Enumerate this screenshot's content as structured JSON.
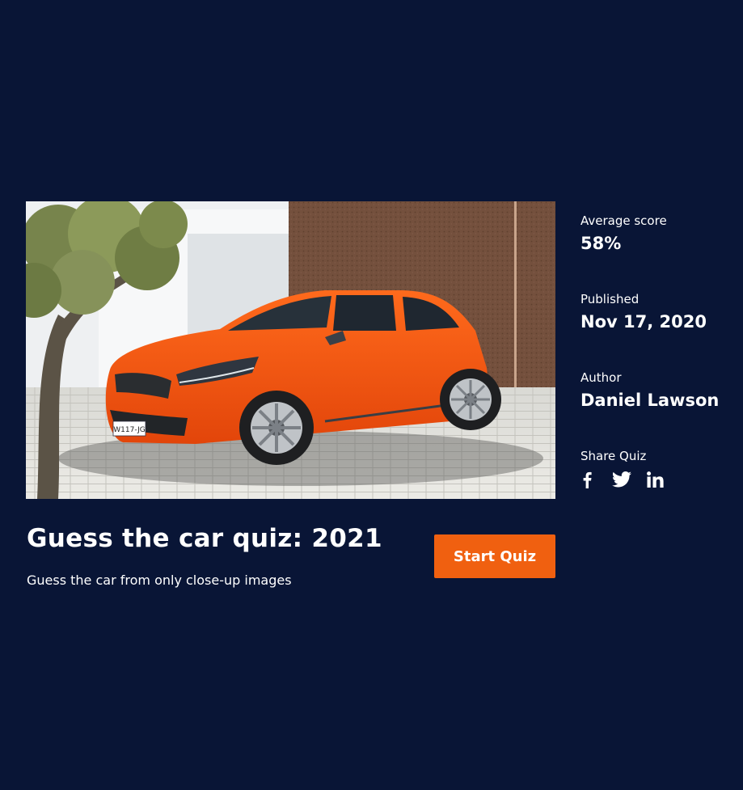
{
  "quiz": {
    "title": "Guess the car quiz: 2021",
    "description": "Guess the car from only close-up images",
    "start_label": "Start Quiz",
    "cover_image": "orange-hatchback-car-photo",
    "plate_text": "W117-JG"
  },
  "stats": {
    "score_label": "Average score",
    "score_value": "58%",
    "published_label": "Published",
    "published_value": "Nov 17, 2020",
    "author_label": "Author",
    "author_value": "Daniel Lawson",
    "share_label": "Share Quiz",
    "share_icons": [
      "facebook-icon",
      "twitter-icon",
      "linkedin-icon"
    ]
  },
  "colors": {
    "background": "#091536",
    "accent": "#f06010",
    "text": "#ffffff"
  }
}
